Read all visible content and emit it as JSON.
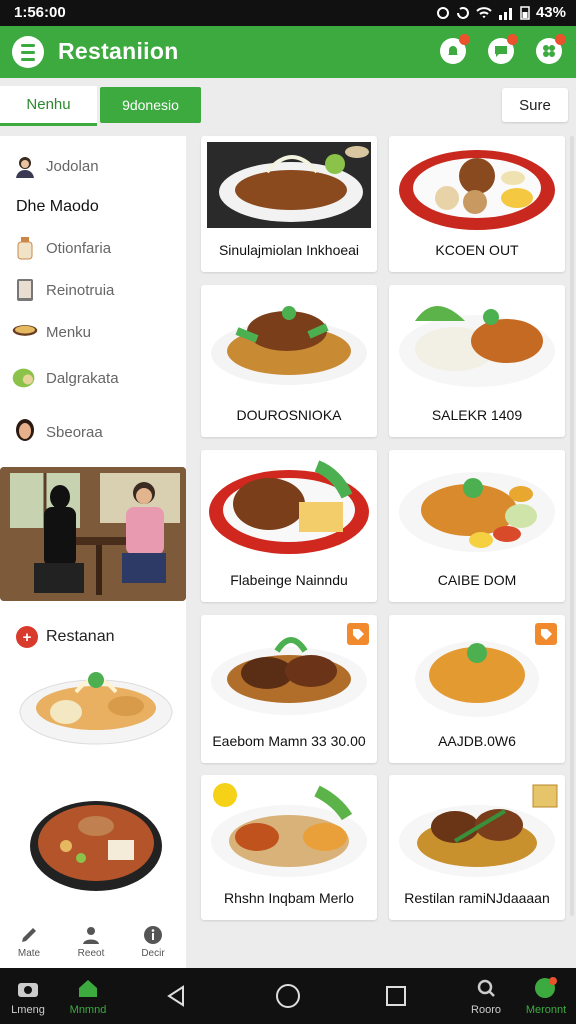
{
  "status": {
    "time": "1:56:00",
    "battery": "43%"
  },
  "appbar": {
    "title": "Restaniion"
  },
  "tabs": {
    "tab1": "Nenhu",
    "tab2": "9donesio",
    "sure": "Sure"
  },
  "sidebar": {
    "header": "Dhe Maodo",
    "items": [
      {
        "label": "Jodolan",
        "icon": "person-avatar-icon"
      },
      {
        "label": "Otionfaria",
        "icon": "bottle-icon"
      },
      {
        "label": "Reinotruia",
        "icon": "tablet-icon"
      },
      {
        "label": "Menku",
        "icon": "bowl-icon"
      },
      {
        "label": "Dalgrakata",
        "icon": "leaf-food-icon"
      },
      {
        "label": "Sbeoraa",
        "icon": "woman-avatar-icon"
      }
    ],
    "restaurant_title": "Restanan",
    "footer": [
      {
        "label": "Mate",
        "icon": "pen-icon"
      },
      {
        "label": "Reeot",
        "icon": "people-icon"
      },
      {
        "label": "Decir",
        "icon": "info-icon"
      }
    ]
  },
  "cards": [
    {
      "label": "Sinulajmiolan Inkhoeai"
    },
    {
      "label": "KCOEN OUT"
    },
    {
      "label": "DOUROSNIOKA"
    },
    {
      "label": "SALEKR 1409"
    },
    {
      "label": "Flabeinge Nainndu"
    },
    {
      "label": "CAIBE DOM"
    },
    {
      "label": "Eaebom Mamn 33 30.00"
    },
    {
      "label": "AAJDB.0W6"
    },
    {
      "label": "Rhshn Inqbam Merlo"
    },
    {
      "label": "Restilan ramiNJdaaaan"
    }
  ],
  "navbar": {
    "left1": "Lmeng",
    "left2": "Mnmnd",
    "right1": "Rooro",
    "right2": "Meronnt"
  },
  "colors": {
    "accent": "#3daa3f",
    "badge": "#f08a2c",
    "logo": "#d83a2c"
  }
}
